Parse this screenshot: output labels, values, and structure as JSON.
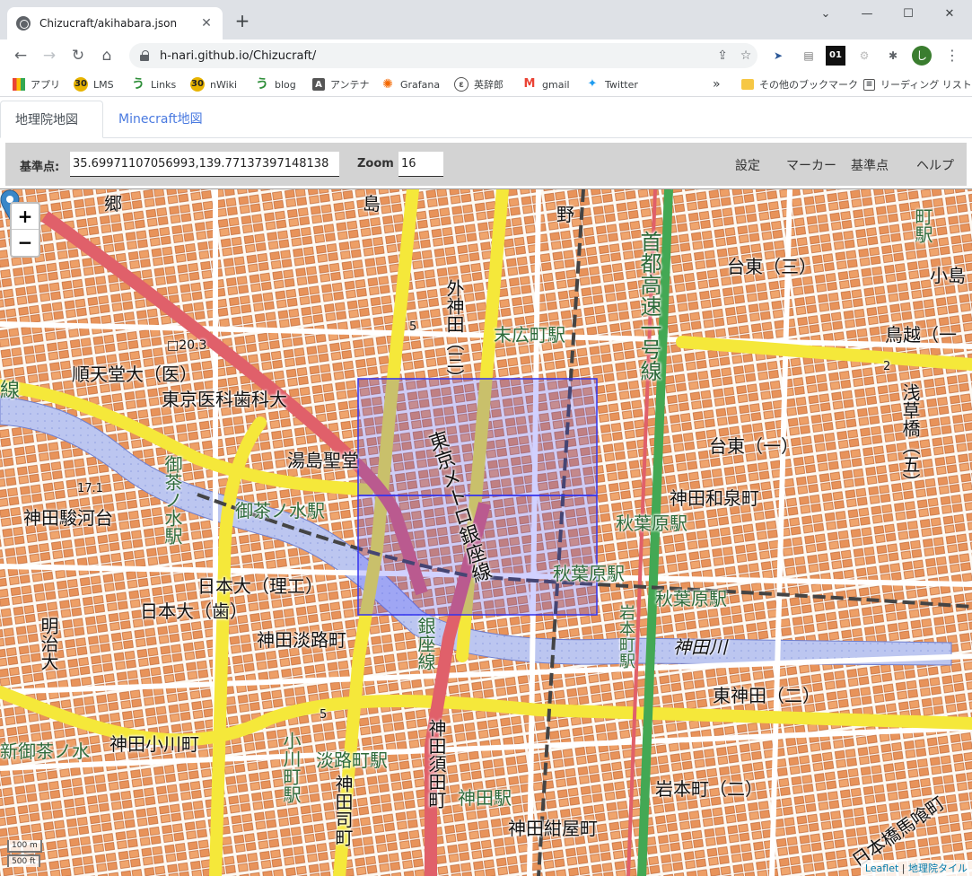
{
  "browser": {
    "tab_title": "Chizucraft/akihabara.json",
    "url": "h-nari.github.io/Chizucraft/",
    "bookmarks": [
      {
        "label": "アプリ",
        "icon": "apps-grid-icon"
      },
      {
        "label": "LMS",
        "icon": "moodle-icon"
      },
      {
        "label": "Links",
        "icon": "pukiwiki-icon"
      },
      {
        "label": "nWiki",
        "icon": "moodle-icon"
      },
      {
        "label": "blog",
        "icon": "pukiwiki-icon"
      },
      {
        "label": "アンテナ",
        "icon": "antenna-icon"
      },
      {
        "label": "Grafana",
        "icon": "grafana-icon"
      },
      {
        "label": "英辞郎",
        "icon": "eijiro-icon"
      },
      {
        "label": "gmail",
        "icon": "gmail-icon"
      },
      {
        "label": "Twitter",
        "icon": "twitter-icon"
      }
    ],
    "other_bookmarks": "その他のブックマーク",
    "reading_list": "リーディング リスト"
  },
  "page": {
    "tabs": [
      {
        "label": "地理院地図",
        "active": true
      },
      {
        "label": "Minecraft地図",
        "active": false
      }
    ],
    "controls": {
      "base_label": "基準点:",
      "base_value": "35.69971107056993,139.77137397148138",
      "zoom_label": "Zoom",
      "zoom_value": "16",
      "menu": [
        "設定",
        "マーカー",
        "基準点",
        "ヘルプ"
      ]
    }
  },
  "map": {
    "zoom_in": "+",
    "zoom_out": "−",
    "scale_m": "100 m",
    "scale_ft": "500 ft",
    "attribution_leaflet": "Leaflet",
    "attribution_sep": " | ",
    "attribution_tiles": "地理院タイル",
    "labels": {
      "juntendo": "順天堂大（医）",
      "tmdu": "東京医科歯科大",
      "yushima": "湯島聖堂",
      "surugadai": "神田駿河台",
      "ochanomizu_line": "御茶ノ水駅",
      "ochanomizu_v": "御茶ノ水駅",
      "nihon_riko": "日本大（理工）",
      "nihon_shi": "日本大（歯）",
      "awajicho": "神田淡路町",
      "meiji": "明治大",
      "kanda_ogawa": "神田小川町",
      "awajicho_st": "淡路町駅",
      "ogawamachi_st": "小川町駅",
      "kanda_st": "神田駅",
      "kanda_konya": "神田紺屋町",
      "iwamoto": "岩本町（二）",
      "higashikanda": "東神田（二）",
      "kandagawa": "神田川",
      "akiba_st1": "秋葉原駅",
      "akiba_st2": "秋葉原駅",
      "akiba_st3": "秋葉原駅",
      "izumi": "神田和泉町",
      "taito1": "台東（一）",
      "taito3": "台東（三）",
      "torigoe": "鳥越（一",
      "suehiro": "末広町駅",
      "sotokanda": "外神田（三）",
      "metro_ginza": "東京メトロ銀座線",
      "shutoko": "首都高速一号線",
      "asakusabashi": "浅草橋（五）",
      "iwamotocho_st": "岩本町駅",
      "kanda_suda": "神田須田町",
      "kanda_tsukasa": "神田司町",
      "elev1": "□20.3",
      "elev2": "17.1",
      "n5a": "5",
      "n5b": "5",
      "n2": "2",
      "ginza_line": "銀座線",
      "kodenmacho": "日本橋馬喰町",
      "sen": "線",
      "shinomiya": "新御茶ノ水",
      "top_shima": "島",
      "top_no": "野",
      "top_go": "郷",
      "top_ekimachi": "町駅",
      "kojima": "小島"
    }
  }
}
